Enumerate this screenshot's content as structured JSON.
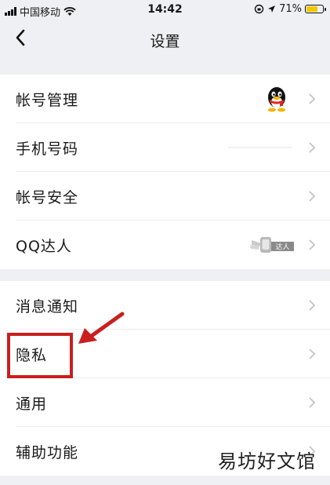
{
  "status_bar": {
    "carrier": "中国移动",
    "time": "14:42",
    "battery_percent": "71%",
    "battery_level": 0.71,
    "battery_color": "#f6c600"
  },
  "nav": {
    "title": "设置",
    "back_icon": "chevron-left-icon"
  },
  "groups": [
    {
      "items": [
        {
          "label": "帐号管理",
          "accessory": "qq-penguin-avatar"
        },
        {
          "label": "手机号码",
          "accessory": "masked-phone"
        },
        {
          "label": "帐号安全",
          "accessory": null
        },
        {
          "label": "QQ达人",
          "accessory": "daren-badge",
          "badge_text": "达人"
        }
      ]
    },
    {
      "items": [
        {
          "label": "消息通知"
        },
        {
          "label": "隐私"
        },
        {
          "label": "通用"
        },
        {
          "label": "辅助功能"
        }
      ]
    }
  ],
  "annotation": {
    "highlight_color": "#c91f1f"
  },
  "watermark": "易坊好文馆"
}
